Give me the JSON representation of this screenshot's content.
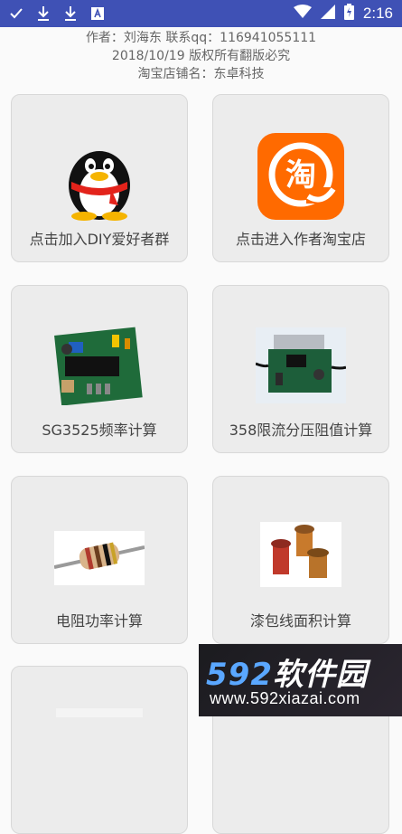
{
  "status_bar": {
    "time": "2:16",
    "icons": [
      "check-icon",
      "download-icon",
      "download-icon",
      "app-a-icon",
      "wifi-icon",
      "signal-icon",
      "battery-charging-icon"
    ]
  },
  "header": {
    "line1": "作者：刘海东   联系qq：116941055111",
    "line2": "2018/10/19   版权所有翻版必究",
    "line3": "淘宝店铺名：东卓科技"
  },
  "cards": [
    {
      "label": "点击加入DIY爱好者群",
      "icon": "qq-penguin-icon"
    },
    {
      "label": "点击进入作者淘宝店",
      "icon": "taobao-icon"
    },
    {
      "label": "SG3525频率计算",
      "icon": "circuit-board-image"
    },
    {
      "label": "358限流分压阻值计算",
      "icon": "circuit-module-image"
    },
    {
      "label": "电阻功率计算",
      "icon": "resistor-image"
    },
    {
      "label": "漆包线面积计算",
      "icon": "enameled-wire-image"
    }
  ],
  "watermark": {
    "logo_number": "592",
    "logo_text": "软件园",
    "url": "www.592xiazai.com"
  },
  "colors": {
    "status_bar": "#3f51b5",
    "card_bg": "#ececec",
    "taobao_orange": "#ff6a00"
  }
}
